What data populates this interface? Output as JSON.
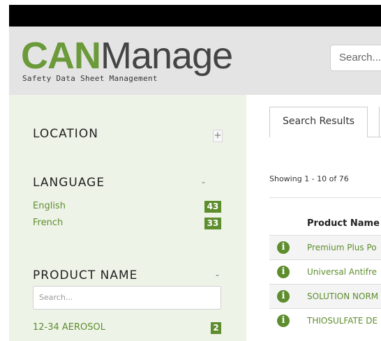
{
  "header": {
    "logo_can": "CAN",
    "logo_manage": "Manage",
    "logo_tagline": "Safety Data Sheet Management",
    "search_placeholder": "Search..."
  },
  "sidebar": {
    "location": {
      "title": "LOCATION",
      "toggle": "+"
    },
    "language": {
      "title": "LANGUAGE",
      "toggle": "-",
      "items": [
        {
          "label": "English",
          "count": "43"
        },
        {
          "label": "French",
          "count": "33"
        }
      ]
    },
    "product_name": {
      "title": "PRODUCT NAME",
      "toggle": "-",
      "search_placeholder": "Search...",
      "items": [
        {
          "label": "12-34 AEROSOL",
          "count": "2"
        }
      ]
    }
  },
  "main": {
    "tabs": [
      {
        "label": "Search Results"
      }
    ],
    "showing": "Showing 1 - 10 of 76",
    "column_header": "Product Name",
    "rows": [
      {
        "name": "Premium Plus Po"
      },
      {
        "name": "Universal Antifre"
      },
      {
        "name": "SOLUTION NORM"
      },
      {
        "name": "THIOSULFATE DE"
      }
    ]
  },
  "colors": {
    "brand_green": "#5e8d2e",
    "logo_green": "#6b9a3a",
    "sidebar_bg": "#eef3e8",
    "header_bg": "#e4e4e4"
  },
  "icons": {
    "row_icon": "info-icon"
  }
}
